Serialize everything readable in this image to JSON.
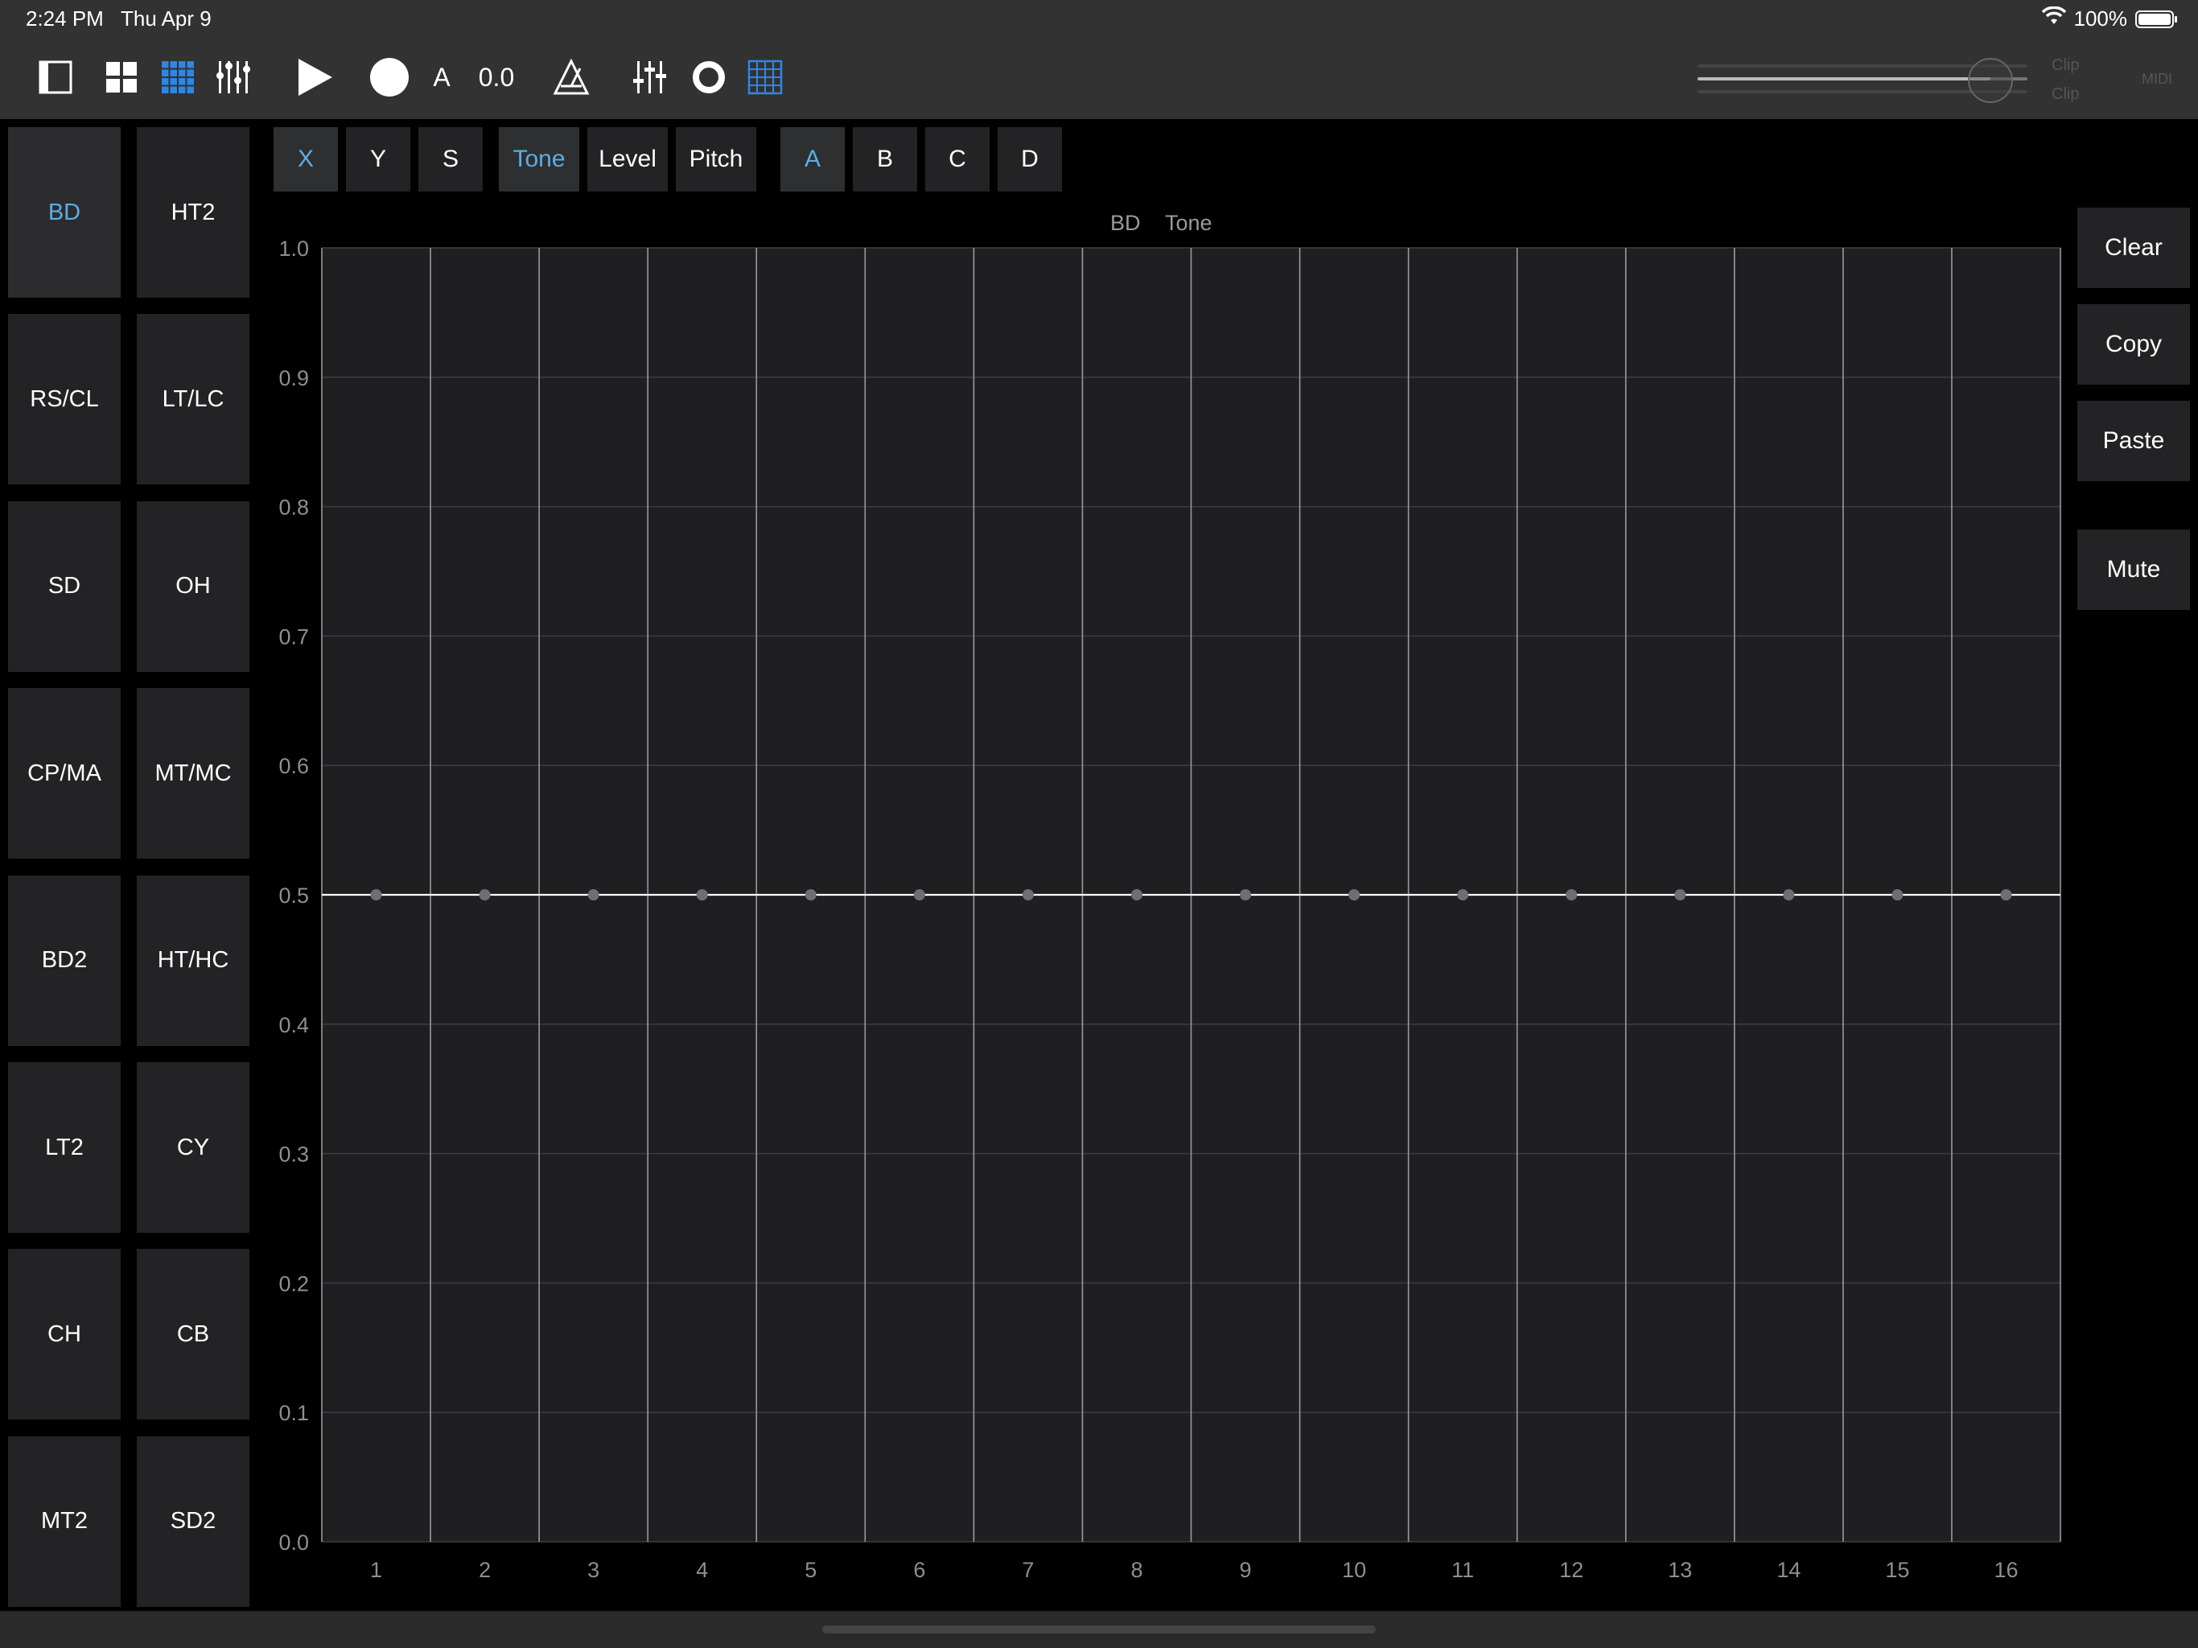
{
  "status": {
    "time": "2:24 PM",
    "date": "Thu Apr 9",
    "battery": "100%"
  },
  "toolbar": {
    "icons": [
      "sidebar-toggle-icon",
      "grid-2x2-icon",
      "grid-4x4-icon",
      "step-sliders-icon",
      "play-icon",
      "record-icon",
      "metronome-icon",
      "mixer-icon",
      "loop-circle-icon",
      "pattern-grid-icon"
    ],
    "pattern_label": "A",
    "tempo_value": "0.0",
    "volume_level": 0.95,
    "clip_labels": [
      "Clip",
      "Clip"
    ],
    "midi_label": "MIDI",
    "accent_color": "#2e86e6"
  },
  "pads": [
    {
      "label": "BD",
      "active": true
    },
    {
      "label": "HT2",
      "active": false
    },
    {
      "label": "RS/CL",
      "active": false
    },
    {
      "label": "LT/LC",
      "active": false
    },
    {
      "label": "SD",
      "active": false
    },
    {
      "label": "OH",
      "active": false
    },
    {
      "label": "CP/MA",
      "active": false
    },
    {
      "label": "MT/MC",
      "active": false
    },
    {
      "label": "BD2",
      "active": false
    },
    {
      "label": "HT/HC",
      "active": false
    },
    {
      "label": "LT2",
      "active": false
    },
    {
      "label": "CY",
      "active": false
    },
    {
      "label": "CH",
      "active": false
    },
    {
      "label": "CB",
      "active": false
    },
    {
      "label": "MT2",
      "active": false
    },
    {
      "label": "SD2",
      "active": false
    }
  ],
  "modes": {
    "axis": [
      {
        "label": "X",
        "active": true
      },
      {
        "label": "Y",
        "active": false
      },
      {
        "label": "S",
        "active": false
      }
    ],
    "param": [
      {
        "label": "Tone",
        "active": true
      },
      {
        "label": "Level",
        "active": false
      },
      {
        "label": "Pitch",
        "active": false
      }
    ],
    "bank": [
      {
        "label": "A",
        "active": true
      },
      {
        "label": "B",
        "active": false
      },
      {
        "label": "C",
        "active": false
      },
      {
        "label": "D",
        "active": false
      }
    ]
  },
  "actions": {
    "clear": "Clear",
    "copy": "Copy",
    "paste": "Paste",
    "mute": "Mute"
  },
  "chart_data": {
    "type": "line",
    "title_instrument": "BD",
    "title_param": "Tone",
    "x": [
      1,
      2,
      3,
      4,
      5,
      6,
      7,
      8,
      9,
      10,
      11,
      12,
      13,
      14,
      15,
      16
    ],
    "values": [
      0.5,
      0.5,
      0.5,
      0.5,
      0.5,
      0.5,
      0.5,
      0.5,
      0.5,
      0.5,
      0.5,
      0.5,
      0.5,
      0.5,
      0.5,
      0.5
    ],
    "y_ticks": [
      "0.0",
      "0.1",
      "0.2",
      "0.3",
      "0.4",
      "0.5",
      "0.6",
      "0.7",
      "0.8",
      "0.9",
      "1.0"
    ],
    "ylim": [
      0,
      1
    ],
    "grid": true
  }
}
